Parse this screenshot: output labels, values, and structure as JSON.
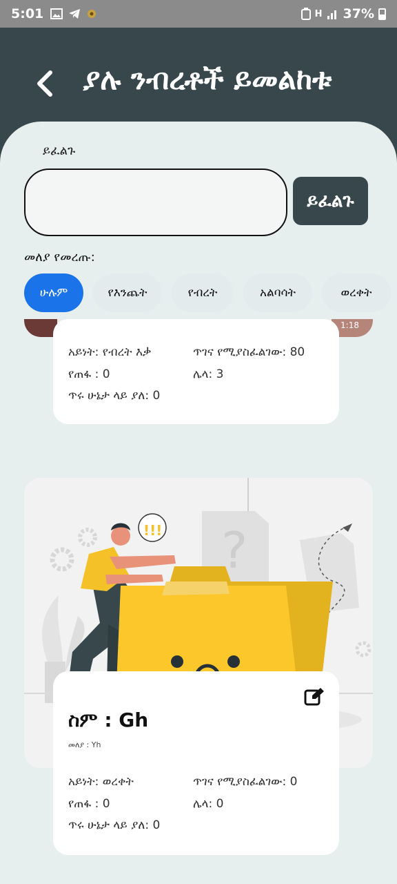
{
  "status_bar": {
    "time": "5:01",
    "battery": "37%",
    "network": "H"
  },
  "header": {
    "title": "ያሉ ንብረቶች ይመልከቱ"
  },
  "search": {
    "label": "ይፈልጉ",
    "value": "",
    "placeholder": "",
    "button_label": "ይፈልጉ"
  },
  "filter": {
    "label": "መለያ የመረጡ:",
    "chips": [
      {
        "label": "ሁሉም",
        "active": true
      },
      {
        "label": "የእንጨት",
        "active": false
      },
      {
        "label": "የብረት",
        "active": false
      },
      {
        "label": "አልባሳት",
        "active": false
      },
      {
        "label": "ወረቀት",
        "active": false
      }
    ]
  },
  "items": [
    {
      "image_timestamp": "1:18",
      "type": "አይነት: የብረት እቃ",
      "needs_repair": "ጥገና የሚያስፈልገው: 80",
      "missing": "የጠፋ : 0",
      "other": "ሌላ: 3",
      "good_condition": "ጥሩ ሁኔታ ላይ ያለ: 0"
    },
    {
      "name": "ስም : Gh",
      "id_label": "መለያ : Yh",
      "type": "አይነት: ወረቀት",
      "needs_repair": "ጥገና የሚያስፈልገው: 0",
      "missing": "የጠፋ : 0",
      "other": "ሌላ: 0",
      "good_condition": "ጥሩ ሁኔታ ላይ ያለ: 0",
      "illustration_alert": "!!!"
    }
  ],
  "colors": {
    "header_bg": "#37474b",
    "sheet_bg": "#e7efee",
    "accent": "#1a73e8",
    "illustration_yellow": "#fcc72a"
  },
  "icons": [
    "back-arrow-icon",
    "edit-icon",
    "gallery-icon",
    "telegram-icon",
    "signal-icon",
    "battery-icon"
  ]
}
